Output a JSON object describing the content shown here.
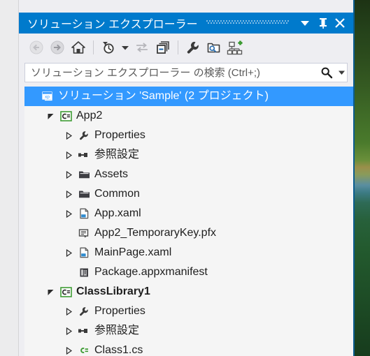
{
  "window": {
    "title": "ソリューション エクスプローラー",
    "buttons": [
      {
        "name": "window-dropdown-button",
        "icon": "chevron-down-icon",
        "label": "▼"
      },
      {
        "name": "auto-hide-pin-button",
        "icon": "pin-icon",
        "label": "⊥"
      },
      {
        "name": "close-button",
        "icon": "close-icon",
        "label": "✕"
      }
    ],
    "accent_color": "#007acc",
    "selection_color": "#3399ff"
  },
  "toolbar": {
    "items": [
      {
        "name": "back-button",
        "icon": "back-arrow-icon",
        "enabled": false
      },
      {
        "name": "forward-button",
        "icon": "forward-arrow-icon",
        "enabled": false
      },
      {
        "name": "home-button",
        "icon": "home-icon",
        "enabled": true
      },
      {
        "name": "toolbar-separator-1",
        "icon": "separator",
        "enabled": false
      },
      {
        "name": "pending-changes-button",
        "icon": "clock-filter-icon",
        "enabled": true
      },
      {
        "name": "pending-changes-dropdown",
        "icon": "chevron-down-icon",
        "enabled": true
      },
      {
        "name": "sync-with-active-document-button",
        "icon": "sync-arrows-icon",
        "enabled": false
      },
      {
        "name": "collapse-all-button",
        "icon": "collapse-all-icon",
        "enabled": true
      },
      {
        "name": "toolbar-separator-2",
        "icon": "separator",
        "enabled": false
      },
      {
        "name": "properties-button",
        "icon": "wrench-icon",
        "enabled": true
      },
      {
        "name": "show-all-files-button",
        "icon": "folder-search-icon",
        "enabled": true
      },
      {
        "name": "view-class-diagram-button",
        "icon": "class-hierarchy-plus-icon",
        "enabled": true
      }
    ]
  },
  "search": {
    "placeholder": "ソリューション エクスプローラー の検索 (Ctrl+;)",
    "value": "",
    "icon": "magnifier-icon",
    "dropdown_icon": "chevron-down-icon"
  },
  "tree": {
    "rows": [
      {
        "label": "ソリューション 'Sample' (2 プロジェクト)",
        "icon": "solution-icon",
        "indent": 0,
        "expander": "none",
        "selected": true,
        "bold": false
      },
      {
        "label": "App2",
        "icon": "csharp-project-icon",
        "indent": 1,
        "expander": "expanded",
        "selected": false,
        "bold": false
      },
      {
        "label": "Properties",
        "icon": "wrench-icon",
        "indent": 2,
        "expander": "collapsed",
        "selected": false,
        "bold": false
      },
      {
        "label": "参照設定",
        "icon": "references-icon",
        "indent": 2,
        "expander": "collapsed",
        "selected": false,
        "bold": false
      },
      {
        "label": "Assets",
        "icon": "folder-icon",
        "indent": 2,
        "expander": "collapsed",
        "selected": false,
        "bold": false
      },
      {
        "label": "Common",
        "icon": "folder-icon",
        "indent": 2,
        "expander": "collapsed",
        "selected": false,
        "bold": false
      },
      {
        "label": "App.xaml",
        "icon": "xaml-file-icon",
        "indent": 2,
        "expander": "collapsed",
        "selected": false,
        "bold": false
      },
      {
        "label": "App2_TemporaryKey.pfx",
        "icon": "certificate-file-icon",
        "indent": 2,
        "expander": "none",
        "selected": false,
        "bold": false
      },
      {
        "label": "MainPage.xaml",
        "icon": "xaml-file-icon",
        "indent": 2,
        "expander": "collapsed",
        "selected": false,
        "bold": false
      },
      {
        "label": "Package.appxmanifest",
        "icon": "manifest-file-icon",
        "indent": 2,
        "expander": "none",
        "selected": false,
        "bold": false
      },
      {
        "label": "ClassLibrary1",
        "icon": "csharp-project-icon",
        "indent": 1,
        "expander": "expanded",
        "selected": false,
        "bold": true
      },
      {
        "label": "Properties",
        "icon": "wrench-icon",
        "indent": 2,
        "expander": "collapsed",
        "selected": false,
        "bold": false
      },
      {
        "label": "参照設定",
        "icon": "references-icon",
        "indent": 2,
        "expander": "collapsed",
        "selected": false,
        "bold": false
      },
      {
        "label": "Class1.cs",
        "icon": "csharp-file-icon",
        "indent": 2,
        "expander": "collapsed",
        "selected": false,
        "bold": false
      }
    ]
  }
}
